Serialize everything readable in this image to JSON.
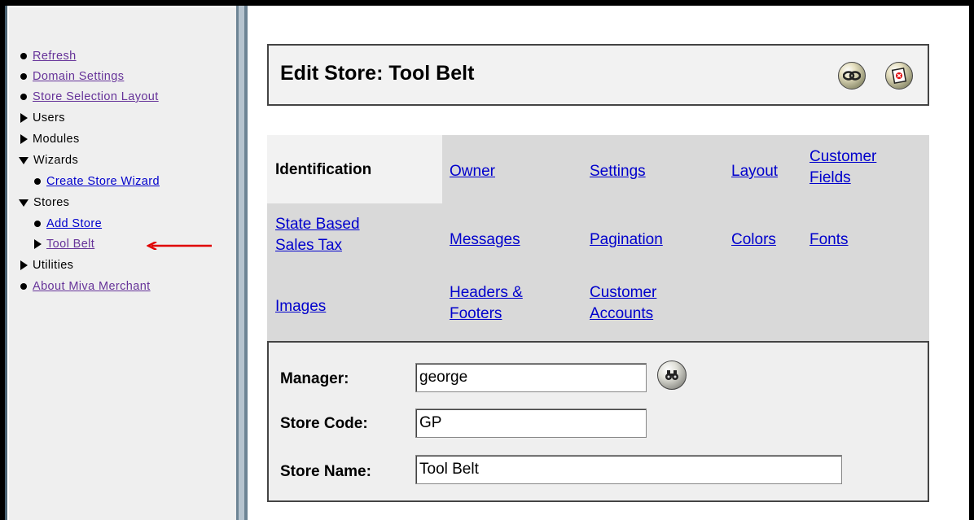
{
  "nav": {
    "items": [
      {
        "label": "Refresh",
        "type": "link"
      },
      {
        "label": "Domain Settings",
        "type": "link"
      },
      {
        "label": "Store Selection Layout",
        "type": "link"
      },
      {
        "label": "Users",
        "type": "collapsed"
      },
      {
        "label": "Modules",
        "type": "collapsed"
      },
      {
        "label": "Wizards",
        "type": "expanded"
      },
      {
        "label": "Create Store Wizard",
        "type": "link"
      },
      {
        "label": "Stores",
        "type": "expanded"
      },
      {
        "label": "Add Store",
        "type": "link"
      },
      {
        "label": "Tool Belt",
        "type": "collapsed-link"
      },
      {
        "label": "Utilities",
        "type": "collapsed"
      },
      {
        "label": "About Miva Merchant",
        "type": "link"
      }
    ],
    "annotation_arrow_color": "#e00000"
  },
  "header": {
    "title": "Edit Store: Tool Belt",
    "icons": [
      "link-icon",
      "close-document-icon"
    ]
  },
  "tabs": {
    "active": "Identification",
    "items": [
      "Owner",
      "Settings",
      "Layout",
      "Customer\nFields",
      "State Based\nSales Tax",
      "Messages",
      "Pagination",
      "Colors",
      "Fonts",
      "Images",
      "Headers &\nFooters",
      "Customer\nAccounts"
    ]
  },
  "form": {
    "manager_label": "Manager:",
    "manager_value": "george",
    "store_code_label": "Store Code:",
    "store_code_value": "GP",
    "store_name_label": "Store Name:",
    "store_name_value": "Tool Belt",
    "lookup_icon": "binoculars-icon"
  },
  "colors": {
    "link": "#0000cc",
    "visited_link": "#663399",
    "panel": "#efefef",
    "tab_strip": "#d9d9d9"
  }
}
